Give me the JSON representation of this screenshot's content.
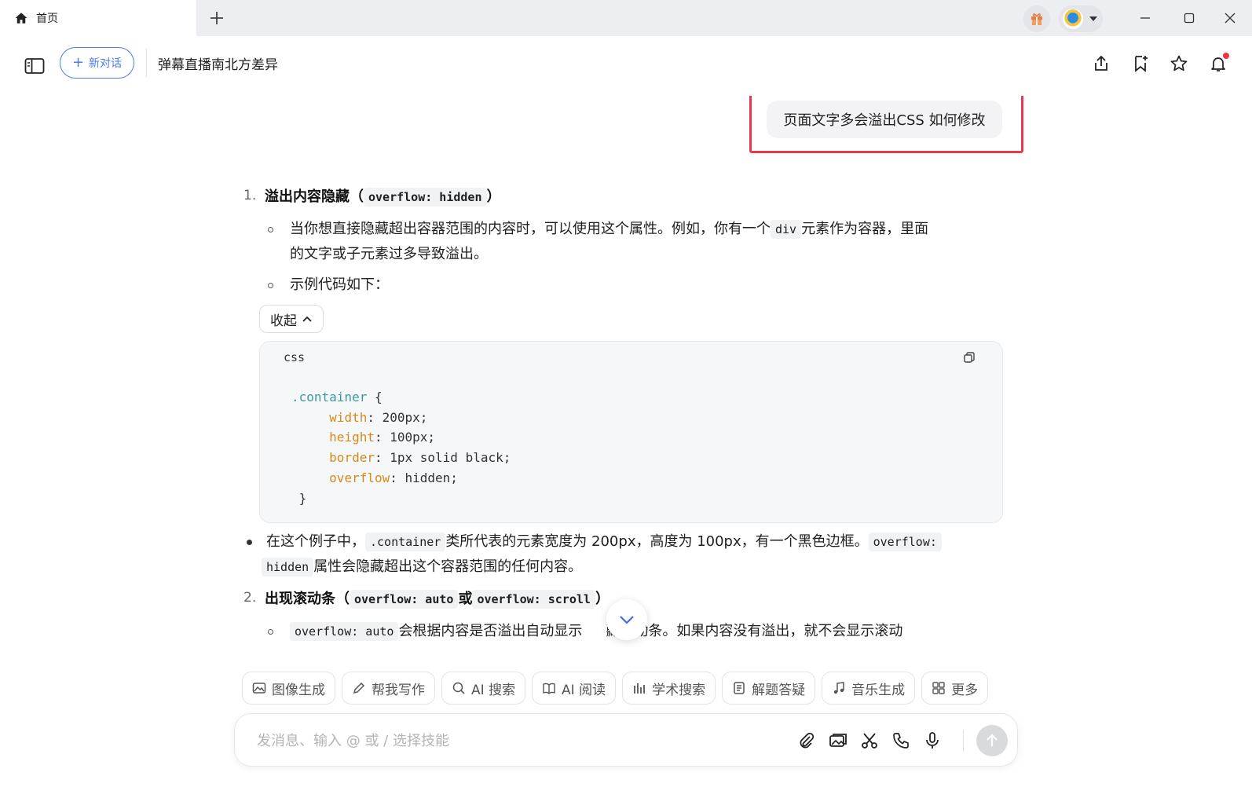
{
  "tab": {
    "label": "首页"
  },
  "header": {
    "new_chat_label": "新对话",
    "conversation_title": "弹幕直播南北方差异"
  },
  "user_message": "页面文字多会溢出CSS 如何修改",
  "answer": {
    "item1": {
      "number": "1.",
      "title": "溢出内容隐藏（",
      "title_code": "overflow: hidden",
      "title_end": "）",
      "bullet1_a": "当你想直接隐藏超出容器范围的内容时，可以使用这个属性。例如，你有一个",
      "bullet1_code": "div",
      "bullet1_b": "元素作为容器，里面",
      "bullet1_c": "的文字或子元素过多导致溢出。",
      "bullet2": "示例代码如下："
    },
    "collapse_label": "收起",
    "code": {
      "language": "css",
      "selector": ".container",
      "open": " {",
      "lines": [
        {
          "prop": "width",
          "value": ": 200px;"
        },
        {
          "prop": "height",
          "value": ": 100px;"
        },
        {
          "prop": "border",
          "value": ": 1px solid black;"
        },
        {
          "prop": "overflow",
          "value": ": hidden;"
        }
      ],
      "close": "}"
    },
    "explain": {
      "a": "在这个例子中，",
      "code1": ".container",
      "b": "类所代表的元素宽度为 200px，高度为 100px，有一个黑色边框。",
      "code2a": "overflow:",
      "code2b": "hidden",
      "c": "属性会隐藏超出这个容器范围的任何内容。"
    },
    "item2": {
      "number": "2.",
      "title": "出现滚动条（",
      "code1": "overflow: auto",
      "mid": "或",
      "code2": "overflow: scroll",
      "title_end": "）",
      "bullet_code": "overflow: auto",
      "bullet_a": "会根据内容是否溢出自动显示",
      "bullet_b": "藏滚动条。如果内容没有溢出，就不会显示滚动"
    }
  },
  "skills": [
    {
      "label": "图像生成",
      "icon": "image-icon"
    },
    {
      "label": "帮我写作",
      "icon": "pen-icon"
    },
    {
      "label": "AI 搜索",
      "icon": "search-icon"
    },
    {
      "label": "AI 阅读",
      "icon": "book-icon"
    },
    {
      "label": "学术搜索",
      "icon": "chart-icon"
    },
    {
      "label": "解题答疑",
      "icon": "question-icon"
    },
    {
      "label": "音乐生成",
      "icon": "music-icon"
    },
    {
      "label": "更多",
      "icon": "grid-icon"
    }
  ],
  "composer": {
    "placeholder": "发消息、输入 @ 或 / 选择技能"
  },
  "colors": {
    "accent": "#4c7cf0",
    "highlight": "#e83a4f",
    "notification": "#f5333f"
  }
}
